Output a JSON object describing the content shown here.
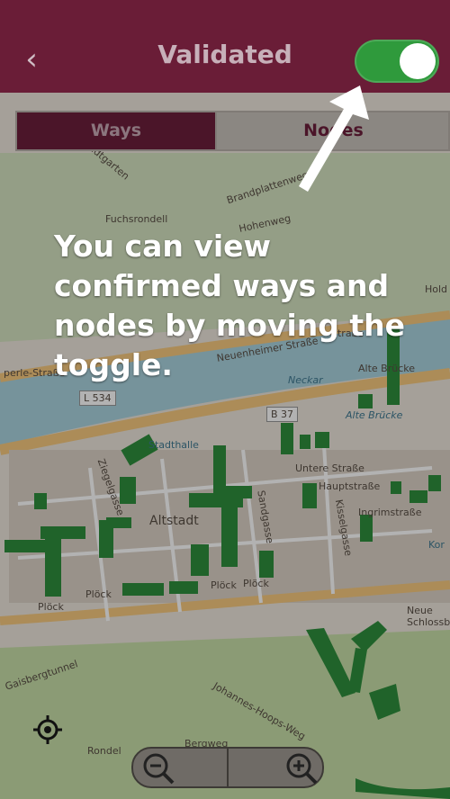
{
  "header": {
    "back_glyph": "‹",
    "title": "Validated",
    "toggle_on": true
  },
  "segments": [
    {
      "label": "Ways",
      "active": true
    },
    {
      "label": "Nodes",
      "active": false
    }
  ],
  "tutorial": {
    "hint": "You can view confirmed ways and nodes by moving the toggle."
  },
  "map": {
    "labels": {
      "fuchsrondell": "Fuchsrondell",
      "brandplattenweg": "Brandplattenweg",
      "neuenheimer": "Neuenheimer Straße",
      "neckar": "Neckar",
      "alte_brucke_1": "Alte Brücke",
      "alte_brucke_2": "Alte Brücke",
      "l534": "L 534",
      "b37": "B 37",
      "stadthalle": "Stadthalle",
      "untere_strasse": "Untere Straße",
      "hauptstrasse": "Hauptstraße",
      "ingrimstrasse": "Ingrimstraße",
      "altstadt": "Altstadt",
      "ploeck_1": "Plöck",
      "ploeck_2": "Plöck",
      "ploeck_3": "Plöck",
      "ploeck_4": "Plöck",
      "ziegelgasse": "Ziegelgasse",
      "sandgasse": "Sandgasse",
      "kisselgasse": "Kisselgasse",
      "neue_schlossberg": "Neue Schlossberg",
      "gaisbergtunnel": "Gaisbergtunnel",
      "johannes_hoops_weg": "Johannes-Hoops-Weg",
      "rondel": "Rondel",
      "bergweg": "Bergweg",
      "holderlinweg": "Hold",
      "hohenweg": "Hohenweg",
      "perle_strasse": "perle-Straße",
      "strasse": "Straße",
      "stadtgarten": "Stadtgarten",
      "kornmarkt": "Kor"
    },
    "colors": {
      "road": "#f7c97e",
      "river": "#aad3df",
      "park": "#c8dfa8",
      "validated_way": "#2f8f3d"
    }
  },
  "controls": {
    "locate_icon": "crosshair-icon",
    "zoom_out_icon": "zoom-out-icon",
    "zoom_in_icon": "zoom-in-icon"
  }
}
